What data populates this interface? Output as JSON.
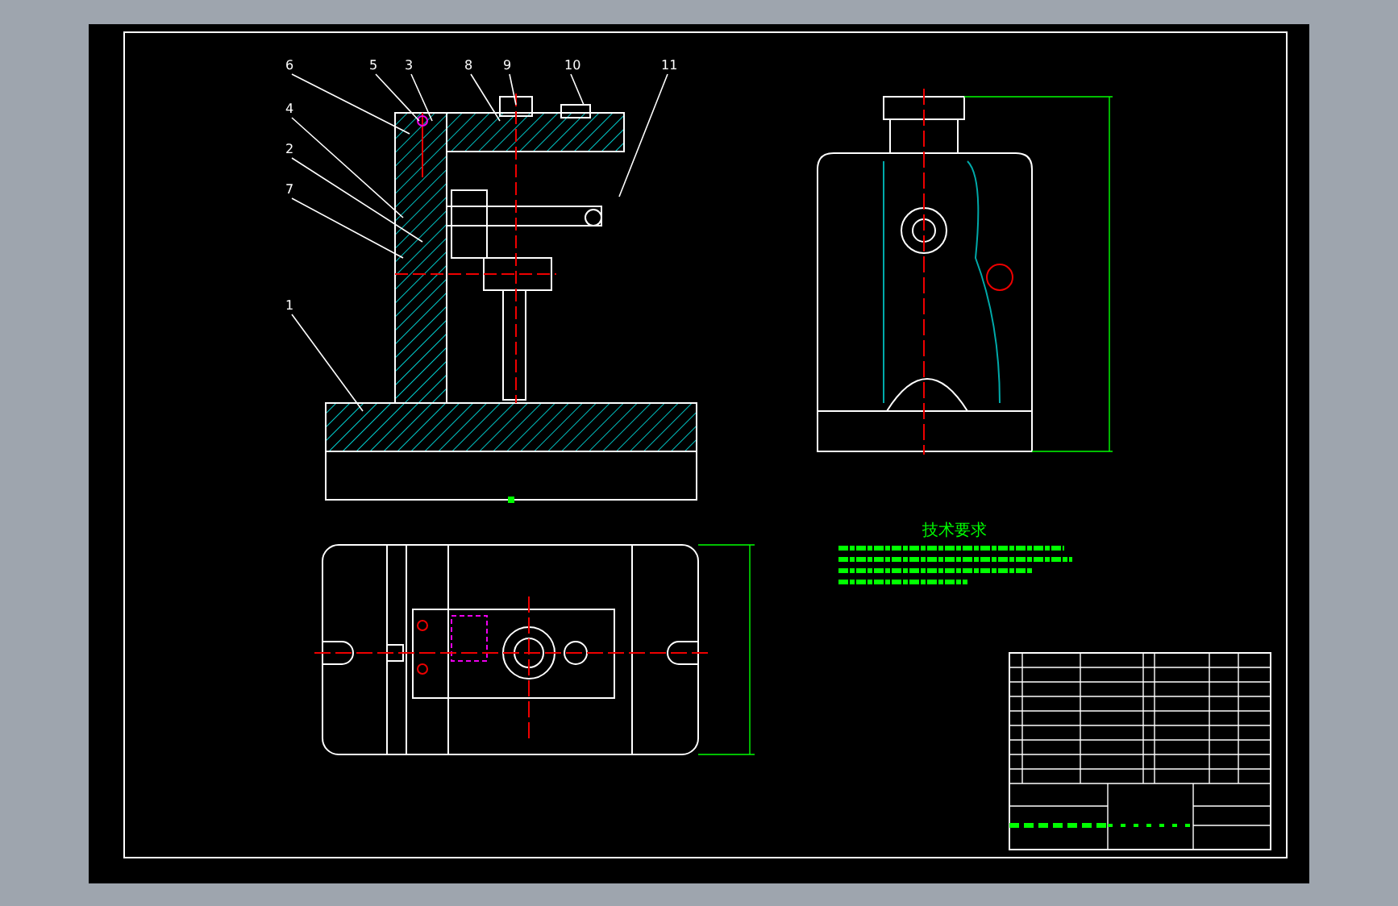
{
  "drawing": {
    "balloons": [
      {
        "label": "6"
      },
      {
        "label": "5"
      },
      {
        "label": "3"
      },
      {
        "label": "8"
      },
      {
        "label": "9"
      },
      {
        "label": "10"
      },
      {
        "label": "11"
      },
      {
        "label": "4"
      },
      {
        "label": "2"
      },
      {
        "label": "7"
      },
      {
        "label": "1"
      }
    ],
    "technical_requirements": {
      "title": "技术要求"
    }
  }
}
